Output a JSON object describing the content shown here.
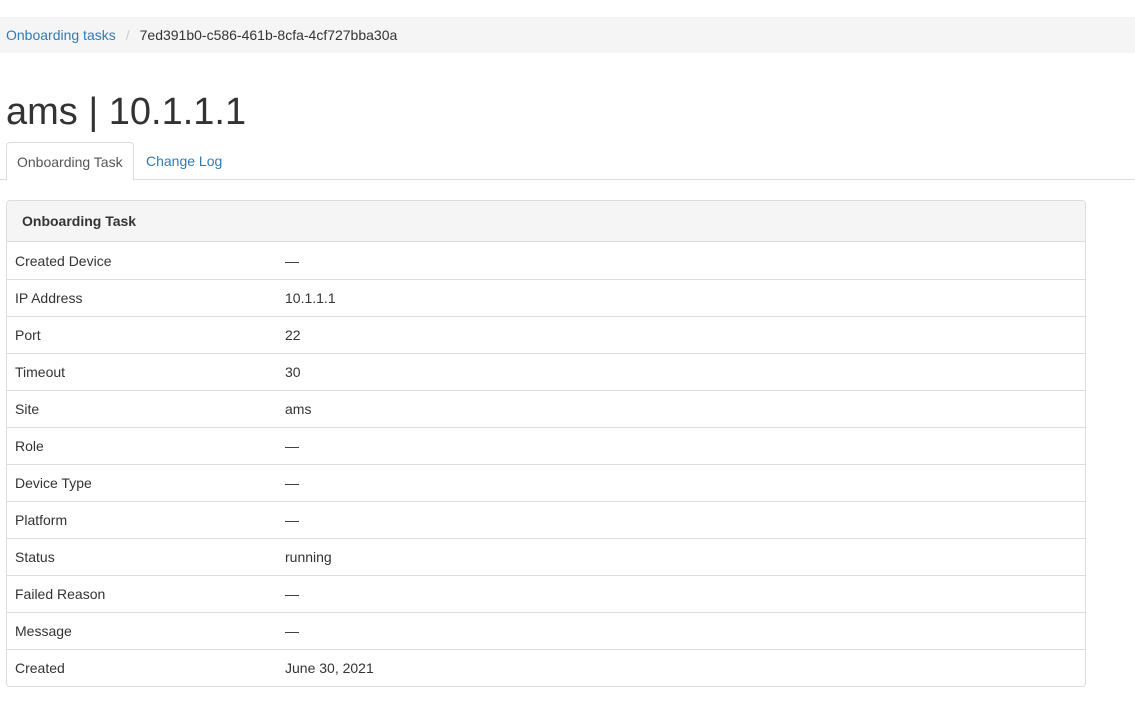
{
  "breadcrumb": {
    "parent_label": "Onboarding tasks",
    "separator": "/",
    "current_label": "7ed391b0-c586-461b-8cfa-4cf727bba30a"
  },
  "page_title": "ams | 10.1.1.1",
  "tabs": [
    {
      "label": "Onboarding Task",
      "active": true
    },
    {
      "label": "Change Log",
      "active": false
    }
  ],
  "panel": {
    "heading": "Onboarding Task",
    "rows": [
      {
        "label": "Created Device",
        "value": "—"
      },
      {
        "label": "IP Address",
        "value": "10.1.1.1"
      },
      {
        "label": "Port",
        "value": "22"
      },
      {
        "label": "Timeout",
        "value": "30"
      },
      {
        "label": "Site",
        "value": "ams"
      },
      {
        "label": "Role",
        "value": "—"
      },
      {
        "label": "Device Type",
        "value": "—"
      },
      {
        "label": "Platform",
        "value": "—"
      },
      {
        "label": "Status",
        "value": "running"
      },
      {
        "label": "Failed Reason",
        "value": "—"
      },
      {
        "label": "Message",
        "value": "—"
      },
      {
        "label": "Created",
        "value": "June 30, 2021"
      }
    ]
  },
  "colors": {
    "link": "#337ab7",
    "breadcrumb_bg": "#f5f5f5",
    "border": "#dddddd"
  }
}
